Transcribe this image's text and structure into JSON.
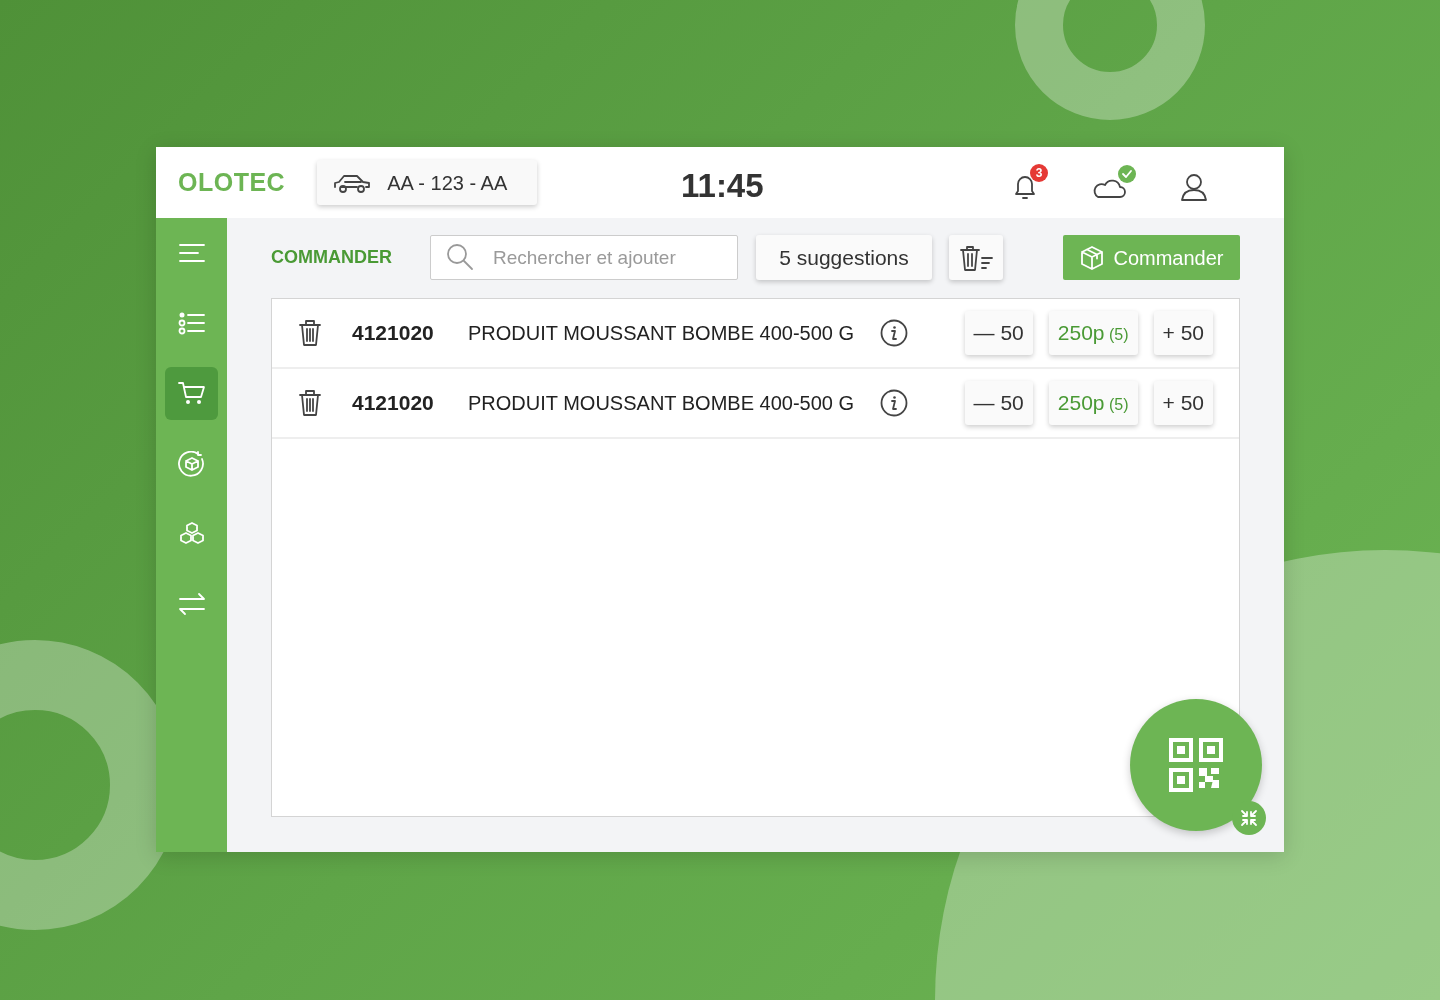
{
  "header": {
    "logo": "OLOTEC",
    "vehicle_plate": "AA - 123 - AA",
    "time": "11:45",
    "notifications": {
      "count": "3"
    },
    "cloud": {
      "synced": true
    }
  },
  "sidebar": {
    "items": [
      {
        "selected": false
      },
      {
        "selected": false
      },
      {
        "selected": true
      },
      {
        "selected": false
      },
      {
        "selected": false
      },
      {
        "selected": false
      }
    ]
  },
  "toolbar": {
    "title": "COMMANDER",
    "search": {
      "placeholder": "Rechercher et ajouter"
    },
    "suggestions": "5 suggestions",
    "order_button": "Commander"
  },
  "rows": [
    {
      "code": "4121020",
      "name": "PRODUIT MOUSSANT BOMBE 400-500 G",
      "minus": "— 50",
      "quantity": "250p",
      "packs": "(5)",
      "plus": "+ 50"
    },
    {
      "code": "4121020",
      "name": "PRODUIT MOUSSANT BOMBE 400-500 G",
      "minus": "— 50",
      "quantity": "250p",
      "packs": "(5)",
      "plus": "+ 50"
    }
  ]
}
